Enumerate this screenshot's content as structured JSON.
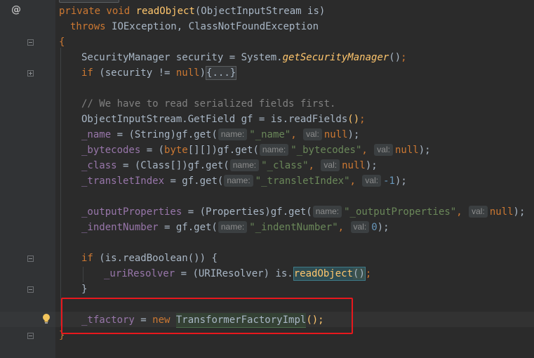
{
  "gutter": {
    "override_marker": "@"
  },
  "code": {
    "line1": {
      "kw": "private void ",
      "method": "readObject",
      "params": "(ObjectInputStream is)"
    },
    "line2": {
      "kw": "throws ",
      "rest": "IOException, ClassNotFoundException"
    },
    "line3": {
      "brace": "{"
    },
    "line4": {
      "a": "SecurityManager security = System.",
      "call": "getSecurityManager",
      "parens": "()",
      "semi": ";"
    },
    "line5": {
      "kw": "if ",
      "a": "(security != ",
      "null_kw": "null",
      "b": ")",
      "folded": "{...}"
    },
    "line6": {
      "comment": "// We have to read serialized fields first."
    },
    "line7": {
      "a": "ObjectInputStream.GetField gf = is.readFields",
      "parens": "()",
      "semi": ";"
    },
    "line8": {
      "field": "_name",
      "a": " = (String)gf.get(",
      "hint1": "name:",
      "s": "\"_name\"",
      "comma": ",",
      "hint2": "val:",
      "v": "null",
      "end": ");"
    },
    "line9": {
      "field": "_bytecodes",
      "a": " = (",
      "kw": "byte",
      "b": "[][])gf.get(",
      "hint1": "name:",
      "s": "\"_bytecodes\"",
      "comma": ",",
      "hint2": "val:",
      "v": "null",
      "end": ");"
    },
    "line10": {
      "field": "_class",
      "a": " = (Class[])gf.get(",
      "hint1": "name:",
      "s": "\"_class\"",
      "comma": ",",
      "hint2": "val:",
      "v": "null",
      "end": ");"
    },
    "line11": {
      "field": "_transletIndex",
      "a": " = gf.get(",
      "hint1": "name:",
      "s": "\"_transletIndex\"",
      "comma": ",",
      "hint2": "val:",
      "v": "-1",
      "end": ");"
    },
    "line12": {
      "field": "_outputProperties",
      "a": " = (Properties)gf.get(",
      "hint1": "name:",
      "s": "\"_outputProperties\"",
      "comma": ",",
      "hint2": "val:",
      "v": "null",
      "end": ");"
    },
    "line13": {
      "field": "_indentNumber",
      "a": " = gf.get(",
      "hint1": "name:",
      "s": "\"_indentNumber\"",
      "comma": ",",
      "hint2": "val:",
      "v": "0",
      "end": ");"
    },
    "line14": {
      "kw": "if ",
      "a": "(is.readBoolean()) {"
    },
    "line15": {
      "field": "_uriResolver",
      "a": " = (URIResolver) is.",
      "call": "readObject",
      "paren_open": "(",
      "paren_close": ")",
      "semi": ";"
    },
    "line16": {
      "brace": "}"
    },
    "line17": {
      "field": "_tfactory",
      "a": " = ",
      "kw": "new ",
      "ctor": "TransformerFactoryImpl",
      "end": "();"
    },
    "line18": {
      "brace": "}"
    }
  },
  "colors": {
    "background": "#2b2b2b",
    "gutter": "#313335",
    "keyword": "#cc7832",
    "method": "#ffc66d",
    "field": "#9876aa",
    "string": "#6a8759",
    "comment": "#808080",
    "number": "#6897bb",
    "highlight_box": "#e8181d"
  },
  "icons": {
    "bulb": "lightbulb-icon",
    "override": "override-icon"
  }
}
